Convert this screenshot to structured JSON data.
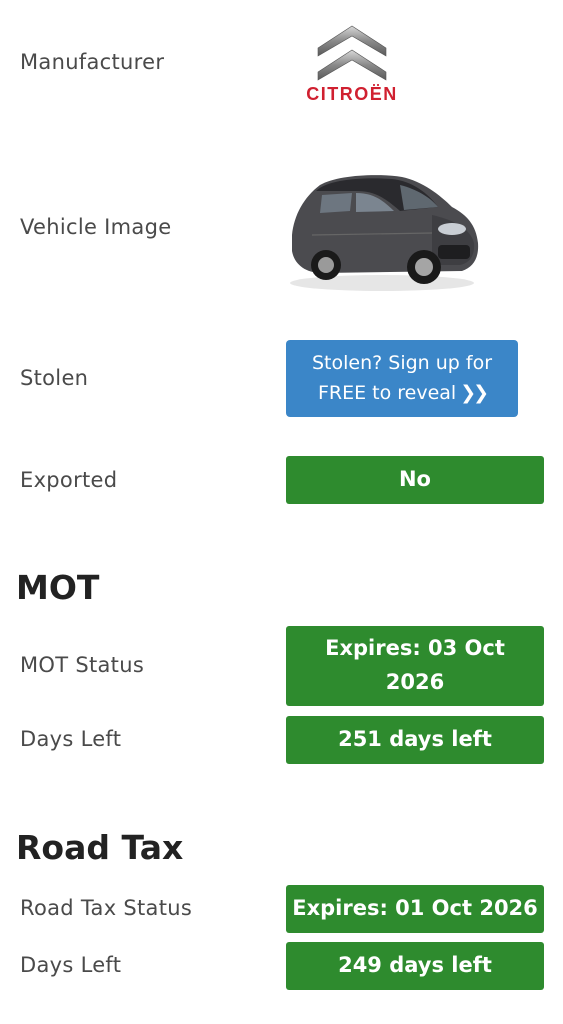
{
  "manufacturer": {
    "label": "Manufacturer",
    "brand_text": "CITROËN",
    "logo_icon": "citroen-chevron-logo"
  },
  "vehicle_image": {
    "label": "Vehicle Image",
    "image_icon": "car-photo"
  },
  "stolen": {
    "label": "Stolen",
    "button_line1": "Stolen? Sign up for",
    "button_line2": "FREE to reveal",
    "chevron": "❯❯"
  },
  "exported": {
    "label": "Exported",
    "value": "No"
  },
  "mot": {
    "heading": "MOT",
    "status_label": "MOT Status",
    "status_value_line1": "Expires: 03 Oct",
    "status_value_line2": "2026",
    "days_label": "Days Left",
    "days_value": "251 days left"
  },
  "road_tax": {
    "heading": "Road Tax",
    "status_label": "Road Tax Status",
    "status_value": "Expires: 01 Oct 2026",
    "days_label": "Days Left",
    "days_value": "249 days left"
  },
  "colors": {
    "green": "#2e8b2e",
    "blue": "#3b86c8",
    "brand_red": "#d02030"
  }
}
